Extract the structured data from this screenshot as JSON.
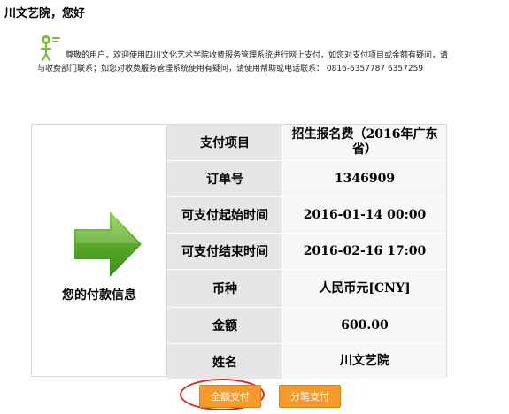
{
  "greeting": "川文艺院，您好",
  "notice": {
    "icon": "info-figure-icon",
    "line1": "尊敬的用户，欢迎使用四川文化艺术学院收费服务管理系统进行网上支付，如您对支付项目或金额有疑问，请",
    "line2": "与收费部门联系；如您对收费服务管理系统使用有疑问，请使用帮助或电话联系：  0816-6357787 6357259"
  },
  "payment_info": {
    "section_label": "您的付款信息",
    "icon": "green-arrow-right-icon",
    "rows": [
      {
        "label": "支付项目",
        "value": "招生报名费（2016年广东省）"
      },
      {
        "label": "订单号",
        "value": "1346909"
      },
      {
        "label": "可支付起始时间",
        "value": "2016-01-14 00:00"
      },
      {
        "label": "可支付结束时间",
        "value": "2016-02-16 17:00"
      },
      {
        "label": "币种",
        "value": "人民币元[CNY]"
      },
      {
        "label": "金额",
        "value": "600.00"
      },
      {
        "label": "姓名",
        "value": "川文艺院"
      }
    ]
  },
  "buttons": {
    "full_payment": "全额支付",
    "split_payment": "分笔支付"
  },
  "colors": {
    "button_bg": "#f79a2e",
    "label_cell_bg": "#e6e6e6",
    "value_cell_bg": "#f7f7f7",
    "highlight_circle": "#e0261f",
    "arrow_green": "#5aa82a"
  }
}
